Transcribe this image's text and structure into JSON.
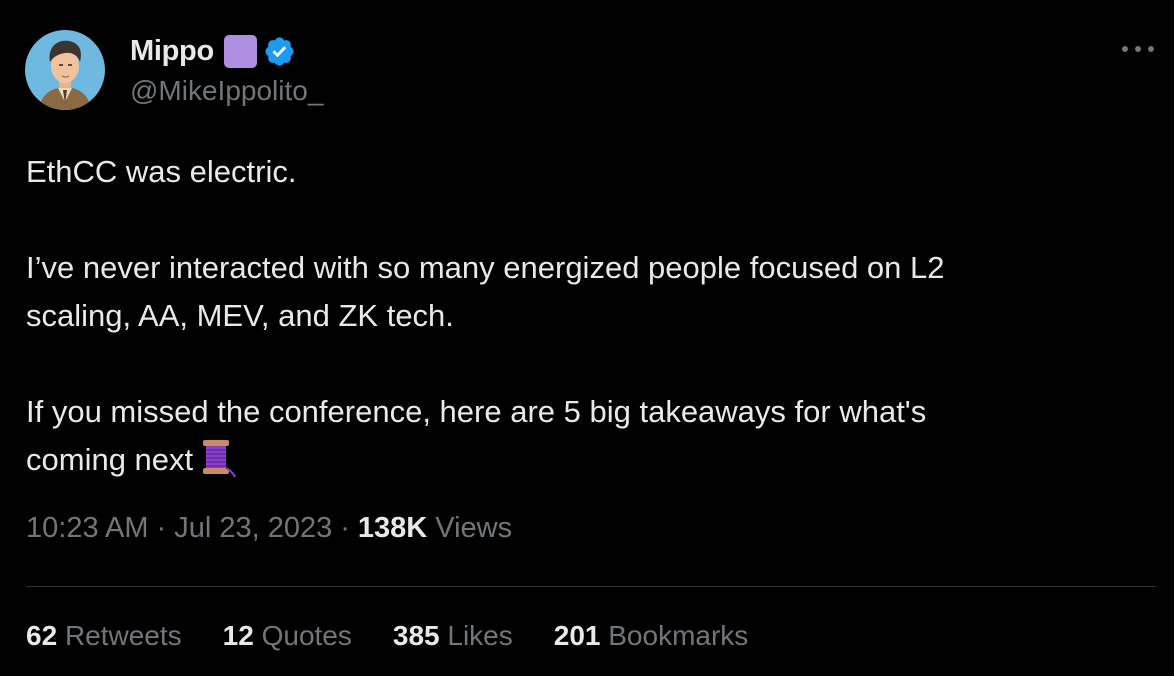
{
  "author": {
    "display_name": "Mippo",
    "handle": "@MikeIppolito_",
    "avatar_icon": "avatar-illustration",
    "name_emoji": "purple-square",
    "verified_icon": "verified-badge-icon",
    "verified_color": "#1d9bf0"
  },
  "more_menu_icon": "ellipsis-icon",
  "tweet": {
    "paragraphs": [
      "EthCC was electric.",
      "I’ve never interacted with so many energized people focused on L2",
      "scaling, AA, MEV, and ZK tech.",
      "If you missed the conference, here are 5 big takeaways for what's",
      "coming next"
    ],
    "trailing_emoji": "thread-spool-icon"
  },
  "meta": {
    "time": "10:23 AM",
    "separator": "·",
    "date": "Jul 23, 2023",
    "views_count": "138K",
    "views_label": "Views"
  },
  "stats": [
    {
      "count": "62",
      "label": "Retweets"
    },
    {
      "count": "12",
      "label": "Quotes"
    },
    {
      "count": "385",
      "label": "Likes"
    },
    {
      "count": "201",
      "label": "Bookmarks"
    }
  ],
  "colors": {
    "background": "#000000",
    "primary_text": "#e7e9ea",
    "secondary_text": "#71767b",
    "divider": "#2f3336",
    "emoji_purple": "#ae8fe0"
  }
}
